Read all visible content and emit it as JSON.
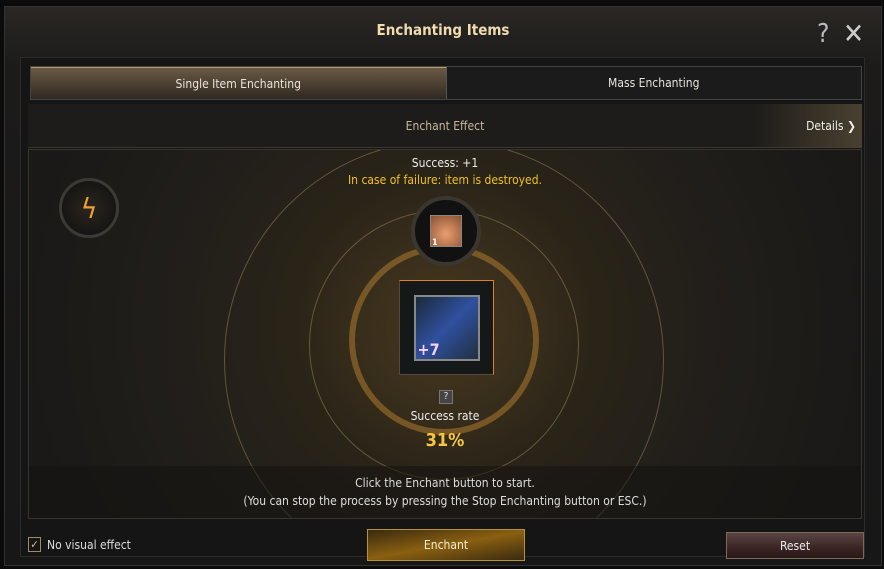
{
  "window": {
    "title": "Enchanting Items",
    "help_icon": "?",
    "close_icon": "✕"
  },
  "tabs": [
    {
      "label": "Single Item Enchanting",
      "active": true
    },
    {
      "label": "Mass Enchanting",
      "active": false
    }
  ],
  "effect": {
    "label": "Enchant Effect",
    "details_label": "Details",
    "details_icon": "❯"
  },
  "stage": {
    "bolt_icon": "ϟ",
    "success_text": "Success: +1",
    "failure_text": "In case of failure: item is destroyed.",
    "material_count": "1",
    "item_level": "+7",
    "help_icon": "?",
    "success_rate_label": "Success rate",
    "success_rate": "31%"
  },
  "messages": {
    "line1": "Click the Enchant button to start.",
    "line2": "(You can stop the process by pressing the Stop Enchanting button or ESC.)"
  },
  "footer": {
    "checkbox_label": "No visual effect",
    "checkbox_checked": true,
    "check_mark": "✓",
    "enchant_label": "Enchant",
    "reset_label": "Reset"
  },
  "colors": {
    "accent_gold": "#f5c840",
    "warning": "#f2c020"
  }
}
